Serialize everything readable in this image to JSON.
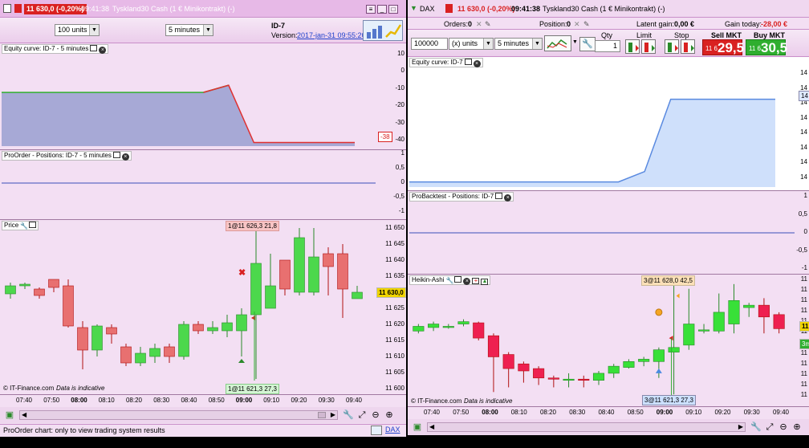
{
  "left": {
    "title": {
      "price_badge": "11 630,0 (-0,20%)",
      "time": "09:41:38",
      "instrument": "Tyskland30 Cash (1 € Minikontrakt) (-)"
    },
    "toolbar": {
      "size_select": "100 units",
      "interval_select": "5 minutes",
      "system_name": "ID-7",
      "version_label": "Version:",
      "version_value": "2017-jan-31 09:55:20"
    },
    "equity_panel": {
      "title": "Equity curve: ID-7 - 5 minutes",
      "y_labels": [
        "10",
        "0",
        "-10",
        "-20",
        "-30",
        "-40"
      ],
      "last_value": "-38"
    },
    "positions_panel": {
      "title": "ProOrder - Positions: ID-7 - 5 minutes",
      "y_labels": [
        "1",
        "0,5",
        "0",
        "-0,5",
        "-1"
      ]
    },
    "price_panel": {
      "title": "Price",
      "y_labels": [
        "11 650",
        "11 645",
        "11 640",
        "11 635",
        "11 630",
        "11 625",
        "11 620",
        "11 615",
        "11 610",
        "11 605",
        "11 600"
      ],
      "current_price": "11 630,0",
      "order_tag_top": "1@11 626,3 21,8",
      "order_tag_bottom": "1@11 621,3 27,3",
      "credit": "© IT-Finance.com",
      "credit_note": "Data is indicative"
    },
    "x_labels": [
      "07:40",
      "07:50",
      "08:00",
      "08:10",
      "08:20",
      "08:30",
      "08:40",
      "08:50",
      "09:00",
      "09:10",
      "09:20",
      "09:30",
      "09:40"
    ],
    "status": "ProOrder chart: only to view trading system results",
    "corner_label": "DAX"
  },
  "right": {
    "title": {
      "symbol": "DAX",
      "price_badge": "11 630,0 (-0,20%)",
      "time": "09:41:38",
      "instrument": "Tyskland30 Cash (1 € Minikontrakt) (-)"
    },
    "header": {
      "orders_label": "Orders:",
      "orders_value": "0",
      "position_label": "Position:",
      "position_value": "0",
      "latent_label": "Latent gain:",
      "latent_value": "0,00 €",
      "gain_label": "Gain today:",
      "gain_value": "-28,00 €"
    },
    "toolbar": {
      "capital_input": "100000",
      "units_select": "(x) units",
      "interval_select": "5 minutes",
      "qty_label": "Qty",
      "qty_value": "1",
      "limit_label": "Limit",
      "stop_label": "Stop",
      "sell_label": "Sell MKT",
      "buy_label": "Buy MKT",
      "sell_price_small": "11 6",
      "sell_price_big": "29,5",
      "buy_price_small": "11 6",
      "buy_price_big": "30,5"
    },
    "equity_panel": {
      "title": "Equity curve: ID-7",
      "y_labels": [
        "14",
        "14",
        "14",
        "14",
        "14",
        "14",
        "14",
        "14"
      ],
      "tag": "14"
    },
    "positions_panel": {
      "title": "ProBacktest - Positions: ID-7",
      "y_labels": [
        "1",
        "0,5",
        "0",
        "-0,5",
        "-1"
      ]
    },
    "price_panel": {
      "title": "Heikin-Ashi",
      "y_labels": [
        "11",
        "11",
        "11",
        "11",
        "11",
        "11",
        "11",
        "11",
        "11",
        "11",
        "11",
        "11"
      ],
      "current_price": "11",
      "stop_tag": "3m",
      "order_tag_top": "3@11 628,0 42,5",
      "order_tag_bottom": "3@11 621,3 27,3",
      "credit": "© IT-Finance.com",
      "credit_note": "Data is indicative"
    },
    "x_labels": [
      "07:40",
      "07:50",
      "08:00",
      "08:10",
      "08:20",
      "08:30",
      "08:40",
      "08:50",
      "09:00",
      "09:10",
      "09:20",
      "09:30",
      "09:40"
    ]
  },
  "chart_data": [
    {
      "type": "area",
      "title": "Equity curve: ID-7 - 5 minutes",
      "x": [
        "07:40",
        "07:50",
        "08:00",
        "08:10",
        "08:20",
        "08:30",
        "08:40",
        "08:50",
        "08:55",
        "09:00",
        "09:05",
        "09:10",
        "09:20",
        "09:30",
        "09:40"
      ],
      "values": [
        -10,
        -10,
        -10,
        -10,
        -10,
        -10,
        -10,
        -10,
        -10,
        -6,
        -38,
        -38,
        -38,
        -38,
        -38
      ],
      "ylim": [
        -40,
        12
      ],
      "grid": false
    },
    {
      "type": "line",
      "title": "ProOrder - Positions: ID-7 - 5 minutes",
      "values": [
        0,
        0,
        0,
        0,
        0,
        0,
        0,
        0,
        0,
        0,
        0,
        0,
        0,
        0,
        0
      ],
      "ylim": [
        -1,
        1
      ]
    },
    {
      "type": "candlestick",
      "title": "Price",
      "x": [
        "07:40",
        "07:45",
        "07:50",
        "07:55",
        "08:00",
        "08:05",
        "08:10",
        "08:15",
        "08:20",
        "08:25",
        "08:30",
        "08:35",
        "08:40",
        "08:45",
        "08:50",
        "08:55",
        "09:00",
        "09:05",
        "09:10",
        "09:15",
        "09:20",
        "09:25",
        "09:30",
        "09:35",
        "09:40"
      ],
      "open": [
        11629.5,
        11632,
        11631,
        11634,
        11632,
        11619,
        11612,
        11619,
        11613,
        11608,
        11610,
        11613,
        11610,
        11620,
        11618,
        11618,
        11618,
        11623,
        11625,
        11640,
        11630,
        11630,
        11642,
        11642,
        11628
      ],
      "close": [
        11632,
        11632.5,
        11629,
        11631.5,
        11619.5,
        11612,
        11619.5,
        11617,
        11608,
        11611,
        11612.5,
        11610,
        11620,
        11618,
        11619,
        11620.5,
        11623,
        11639,
        11632,
        11631,
        11647,
        11641,
        11638,
        11631,
        11630
      ],
      "high": [
        11633,
        11633,
        11631.5,
        11634,
        11634,
        11621,
        11620,
        11620,
        11614,
        11613,
        11614,
        11614,
        11621,
        11621,
        11621,
        11623,
        11625,
        11650,
        11642,
        11636,
        11650,
        11650,
        11644,
        11645,
        11632
      ],
      "low": [
        11628,
        11631,
        11628,
        11630,
        11619,
        11606,
        11610,
        11614,
        11607,
        11607,
        11608,
        11608,
        11609,
        11617,
        11617,
        11616,
        11610,
        11603,
        11629,
        11629,
        11629,
        11629,
        11629,
        11622,
        11628
      ],
      "ylim": [
        11600,
        11650
      ]
    },
    {
      "type": "area",
      "title": "Equity curve: ID-7",
      "values": [
        0,
        0,
        0,
        0,
        0,
        0,
        0,
        0,
        0,
        0.1,
        0.8,
        0.8,
        0.8,
        0.8,
        0.8
      ],
      "ylim": [
        -0.05,
        1.1
      ],
      "grid": false
    },
    {
      "type": "line",
      "title": "ProBacktest - Positions: ID-7",
      "values": [
        0,
        0,
        0,
        0,
        0,
        0,
        0,
        0,
        0,
        0,
        0,
        0,
        0,
        0,
        0
      ],
      "ylim": [
        -1,
        1
      ]
    },
    {
      "type": "candlestick",
      "title": "Heikin-Ashi",
      "x": [
        "07:40",
        "07:45",
        "07:50",
        "07:55",
        "08:00",
        "08:05",
        "08:10",
        "08:15",
        "08:20",
        "08:25",
        "08:30",
        "08:35",
        "08:40",
        "08:45",
        "08:50",
        "08:55",
        "09:00",
        "09:05",
        "09:10",
        "09:15",
        "09:20",
        "09:25",
        "09:30",
        "09:35",
        "09:40"
      ],
      "open": [
        11630,
        11631.5,
        11632,
        11633,
        11633.5,
        11628,
        11620,
        11616,
        11614,
        11610,
        11609.5,
        11609.5,
        11609,
        11612,
        11614.5,
        11617,
        11617,
        11621,
        11624,
        11630,
        11630,
        11633,
        11640,
        11641,
        11637
      ],
      "close": [
        11632,
        11633,
        11632,
        11634,
        11627,
        11619,
        11614,
        11613,
        11610,
        11609.5,
        11609.5,
        11609,
        11612,
        11615,
        11617,
        11618,
        11622,
        11623,
        11633,
        11630.5,
        11638,
        11643,
        11641,
        11636,
        11631
      ],
      "high": [
        11633,
        11634,
        11633,
        11635,
        11634,
        11629,
        11621,
        11617,
        11615,
        11611,
        11612,
        11611,
        11613,
        11616,
        11618,
        11619,
        11623,
        11650,
        11648,
        11633,
        11646,
        11650,
        11642,
        11644,
        11638
      ],
      "low": [
        11629,
        11630,
        11631,
        11632,
        11626,
        11604,
        11606,
        11608,
        11607,
        11606,
        11606,
        11606,
        11607,
        11610,
        11614,
        11615,
        11610,
        11603,
        11622,
        11629,
        11629,
        11629,
        11636,
        11629,
        11629
      ],
      "ylim": [
        11600,
        11652
      ]
    }
  ]
}
